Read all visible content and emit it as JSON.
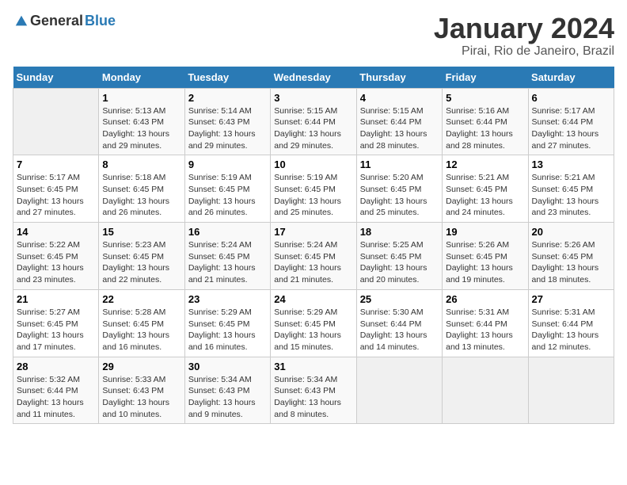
{
  "header": {
    "logo": {
      "text1": "General",
      "text2": "Blue"
    },
    "title": "January 2024",
    "location": "Pirai, Rio de Janeiro, Brazil"
  },
  "columns": [
    "Sunday",
    "Monday",
    "Tuesday",
    "Wednesday",
    "Thursday",
    "Friday",
    "Saturday"
  ],
  "weeks": [
    [
      {
        "day": "",
        "info": ""
      },
      {
        "day": "1",
        "info": "Sunrise: 5:13 AM\nSunset: 6:43 PM\nDaylight: 13 hours\nand 29 minutes."
      },
      {
        "day": "2",
        "info": "Sunrise: 5:14 AM\nSunset: 6:43 PM\nDaylight: 13 hours\nand 29 minutes."
      },
      {
        "day": "3",
        "info": "Sunrise: 5:15 AM\nSunset: 6:44 PM\nDaylight: 13 hours\nand 29 minutes."
      },
      {
        "day": "4",
        "info": "Sunrise: 5:15 AM\nSunset: 6:44 PM\nDaylight: 13 hours\nand 28 minutes."
      },
      {
        "day": "5",
        "info": "Sunrise: 5:16 AM\nSunset: 6:44 PM\nDaylight: 13 hours\nand 28 minutes."
      },
      {
        "day": "6",
        "info": "Sunrise: 5:17 AM\nSunset: 6:44 PM\nDaylight: 13 hours\nand 27 minutes."
      }
    ],
    [
      {
        "day": "7",
        "info": "Sunrise: 5:17 AM\nSunset: 6:45 PM\nDaylight: 13 hours\nand 27 minutes."
      },
      {
        "day": "8",
        "info": "Sunrise: 5:18 AM\nSunset: 6:45 PM\nDaylight: 13 hours\nand 26 minutes."
      },
      {
        "day": "9",
        "info": "Sunrise: 5:19 AM\nSunset: 6:45 PM\nDaylight: 13 hours\nand 26 minutes."
      },
      {
        "day": "10",
        "info": "Sunrise: 5:19 AM\nSunset: 6:45 PM\nDaylight: 13 hours\nand 25 minutes."
      },
      {
        "day": "11",
        "info": "Sunrise: 5:20 AM\nSunset: 6:45 PM\nDaylight: 13 hours\nand 25 minutes."
      },
      {
        "day": "12",
        "info": "Sunrise: 5:21 AM\nSunset: 6:45 PM\nDaylight: 13 hours\nand 24 minutes."
      },
      {
        "day": "13",
        "info": "Sunrise: 5:21 AM\nSunset: 6:45 PM\nDaylight: 13 hours\nand 23 minutes."
      }
    ],
    [
      {
        "day": "14",
        "info": "Sunrise: 5:22 AM\nSunset: 6:45 PM\nDaylight: 13 hours\nand 23 minutes."
      },
      {
        "day": "15",
        "info": "Sunrise: 5:23 AM\nSunset: 6:45 PM\nDaylight: 13 hours\nand 22 minutes."
      },
      {
        "day": "16",
        "info": "Sunrise: 5:24 AM\nSunset: 6:45 PM\nDaylight: 13 hours\nand 21 minutes."
      },
      {
        "day": "17",
        "info": "Sunrise: 5:24 AM\nSunset: 6:45 PM\nDaylight: 13 hours\nand 21 minutes."
      },
      {
        "day": "18",
        "info": "Sunrise: 5:25 AM\nSunset: 6:45 PM\nDaylight: 13 hours\nand 20 minutes."
      },
      {
        "day": "19",
        "info": "Sunrise: 5:26 AM\nSunset: 6:45 PM\nDaylight: 13 hours\nand 19 minutes."
      },
      {
        "day": "20",
        "info": "Sunrise: 5:26 AM\nSunset: 6:45 PM\nDaylight: 13 hours\nand 18 minutes."
      }
    ],
    [
      {
        "day": "21",
        "info": "Sunrise: 5:27 AM\nSunset: 6:45 PM\nDaylight: 13 hours\nand 17 minutes."
      },
      {
        "day": "22",
        "info": "Sunrise: 5:28 AM\nSunset: 6:45 PM\nDaylight: 13 hours\nand 16 minutes."
      },
      {
        "day": "23",
        "info": "Sunrise: 5:29 AM\nSunset: 6:45 PM\nDaylight: 13 hours\nand 16 minutes."
      },
      {
        "day": "24",
        "info": "Sunrise: 5:29 AM\nSunset: 6:45 PM\nDaylight: 13 hours\nand 15 minutes."
      },
      {
        "day": "25",
        "info": "Sunrise: 5:30 AM\nSunset: 6:44 PM\nDaylight: 13 hours\nand 14 minutes."
      },
      {
        "day": "26",
        "info": "Sunrise: 5:31 AM\nSunset: 6:44 PM\nDaylight: 13 hours\nand 13 minutes."
      },
      {
        "day": "27",
        "info": "Sunrise: 5:31 AM\nSunset: 6:44 PM\nDaylight: 13 hours\nand 12 minutes."
      }
    ],
    [
      {
        "day": "28",
        "info": "Sunrise: 5:32 AM\nSunset: 6:44 PM\nDaylight: 13 hours\nand 11 minutes."
      },
      {
        "day": "29",
        "info": "Sunrise: 5:33 AM\nSunset: 6:43 PM\nDaylight: 13 hours\nand 10 minutes."
      },
      {
        "day": "30",
        "info": "Sunrise: 5:34 AM\nSunset: 6:43 PM\nDaylight: 13 hours\nand 9 minutes."
      },
      {
        "day": "31",
        "info": "Sunrise: 5:34 AM\nSunset: 6:43 PM\nDaylight: 13 hours\nand 8 minutes."
      },
      {
        "day": "",
        "info": ""
      },
      {
        "day": "",
        "info": ""
      },
      {
        "day": "",
        "info": ""
      }
    ]
  ],
  "colors": {
    "header_bg": "#2a7ab5",
    "header_text": "#ffffff",
    "accent": "#2a7ab5"
  }
}
